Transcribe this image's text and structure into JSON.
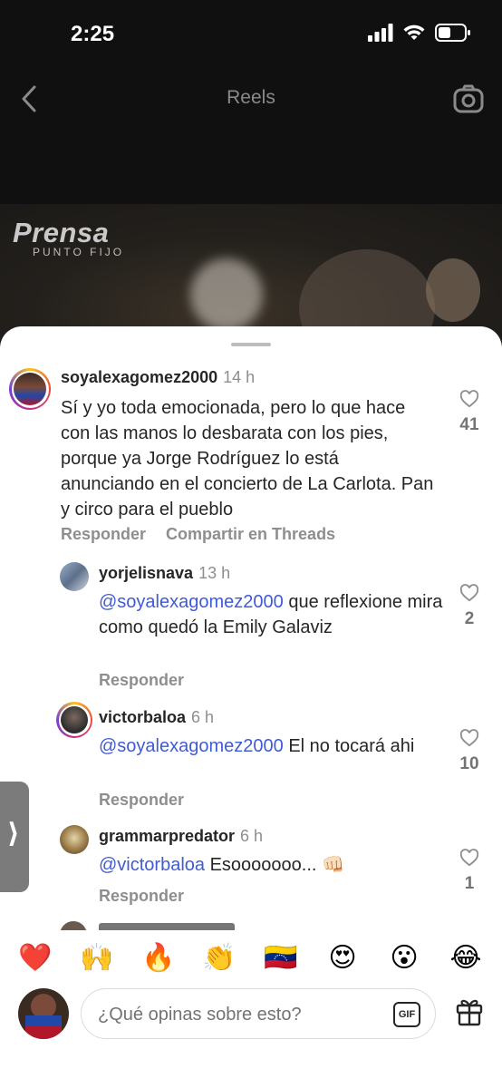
{
  "status": {
    "time": "2:25"
  },
  "nav": {
    "title": "Reels"
  },
  "video": {
    "brand": "Prensa",
    "brand_sub": "PUNTO FIJO"
  },
  "comments": [
    {
      "username": "soyalexagomez2000",
      "time": "14 h",
      "text": "Sí y yo toda emocionada, pero lo que hace con las manos lo desbarata con los pies, porque ya Jorge Rodríguez lo está anunciando en el concierto de La Carlota. Pan y circo para el pueblo",
      "reply": "Responder",
      "share": "Compartir en Threads",
      "likes": "41"
    },
    {
      "username": "yorjelisnava",
      "time": "13 h",
      "mention": "@soyalexagomez2000",
      "text": " que reflexione mira como quedó la Emily Galaviz",
      "reply": "Responder",
      "likes": "2"
    },
    {
      "username": "victorbaloa",
      "time": "6 h",
      "mention": "@soyalexagomez2000",
      "text": " El no tocará ahi",
      "reply": "Responder",
      "likes": "10"
    },
    {
      "username": "grammarpredator",
      "time": "6 h",
      "mention": "@victorbaloa",
      "text": " Esooooooo... 👊🏻",
      "reply": "Responder",
      "likes": "1"
    }
  ],
  "emoji_bar": [
    "❤️",
    "🙌",
    "🔥",
    "👏",
    "🇻🇪",
    "😍",
    "😮",
    "😂"
  ],
  "input": {
    "placeholder": "¿Qué opinas sobre esto?",
    "gif_label": "GIF"
  },
  "side_tab": {
    "label": "⟩"
  }
}
